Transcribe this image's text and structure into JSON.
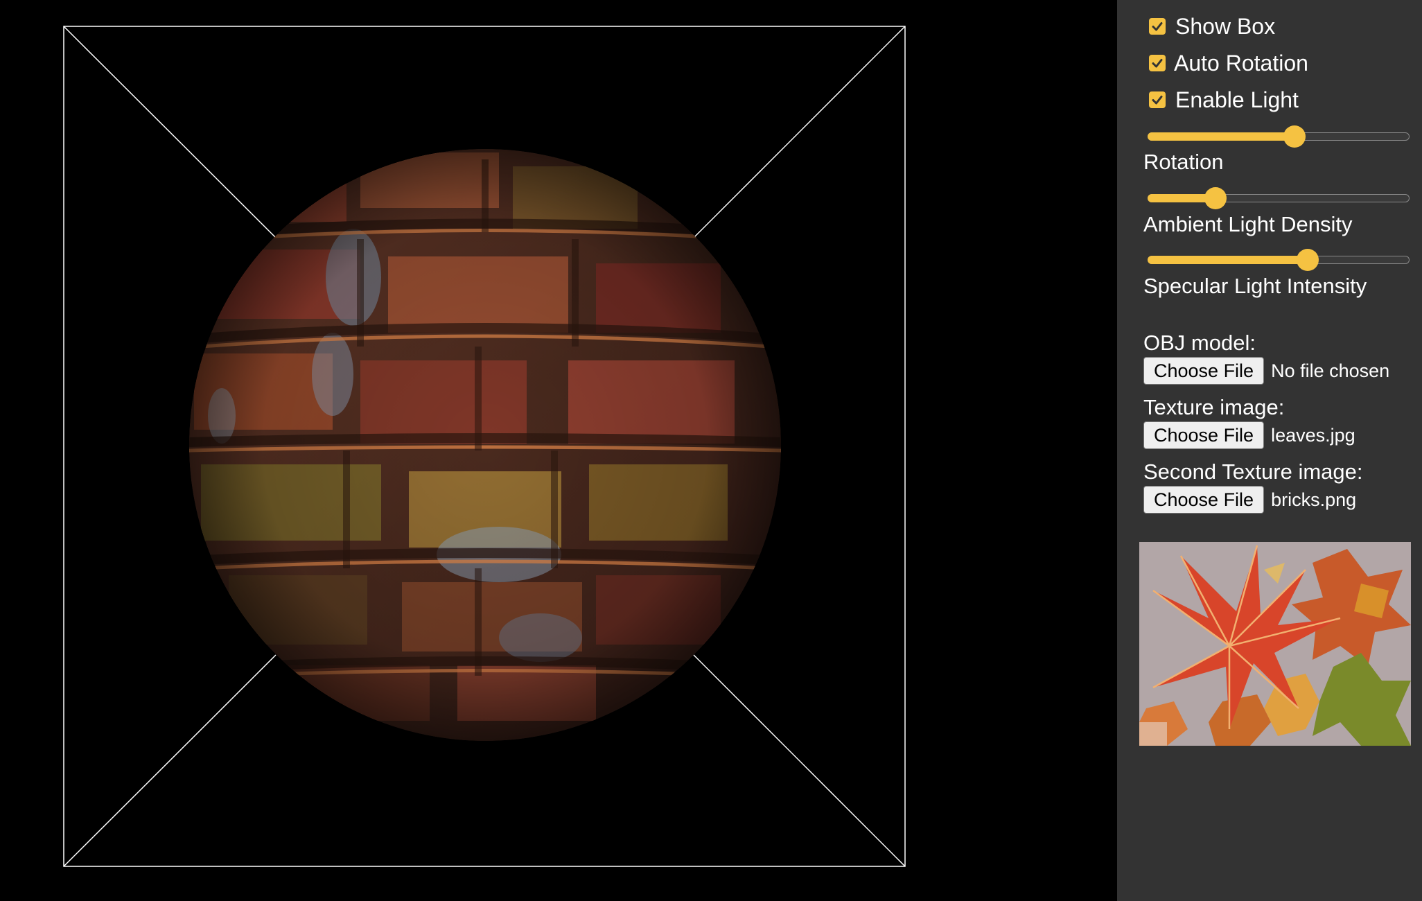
{
  "controls": {
    "checkboxes": [
      {
        "label": "Show Box",
        "checked": true
      },
      {
        "label": "Auto Rotation",
        "checked": true
      },
      {
        "label": "Enable Light",
        "checked": true
      }
    ],
    "sliders": [
      {
        "label": "Rotation",
        "value_fraction": 0.56
      },
      {
        "label": "Ambient Light Density",
        "value_fraction": 0.26
      },
      {
        "label": "Specular Light Intensity",
        "value_fraction": 0.61
      }
    ],
    "file_inputs": [
      {
        "label": "OBJ model:",
        "button": "Choose File",
        "file": "No file chosen"
      },
      {
        "label": "Texture image:",
        "button": "Choose File",
        "file": "leaves.jpg"
      },
      {
        "label": "Second Texture image:",
        "button": "Choose File",
        "file": "bricks.png"
      }
    ]
  },
  "colors": {
    "accent": "#f5c242",
    "panel_bg": "#333333",
    "canvas_bg": "#000000",
    "box_lines": "#ffffff"
  },
  "icons": {
    "checkbox": "checkmark-icon"
  }
}
